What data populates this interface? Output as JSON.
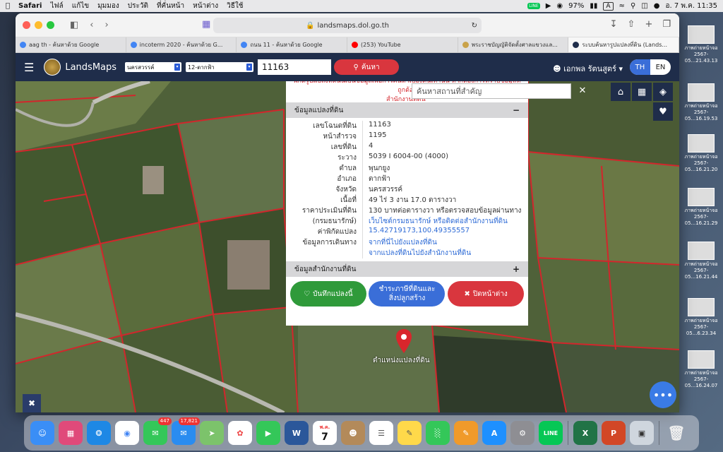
{
  "menubar": {
    "apple": "",
    "app": "Safari",
    "items": [
      "ไฟล์",
      "แก้ไข",
      "มุมมอง",
      "ประวัติ",
      "ที่คั่นหน้า",
      "หน้าต่าง",
      "วิธีใช้"
    ],
    "battery": "97%",
    "input_source": "A",
    "clock": "อ. 7 พ.ค.  11:35"
  },
  "safari": {
    "url": "landsmaps.dol.go.th",
    "tabs": [
      {
        "label": "aag th - ค้นหาด้วย Google",
        "color": "#4285f4"
      },
      {
        "label": "incoterm 2020 - ค้นหาด้วย G...",
        "color": "#4285f4"
      },
      {
        "label": "ถนน 11 - ค้นหาด้วย Google",
        "color": "#4285f4"
      },
      {
        "label": "(253) YouTube",
        "color": "#ff0000"
      },
      {
        "label": "พระราชบัญญัติจัดตั้งศาลแขวงแล...",
        "color": "#c9a24a"
      },
      {
        "label": "ระบบค้นหารูปแปลงที่ดิน (Lands...",
        "color": "#1f2d4a"
      }
    ]
  },
  "landsmaps": {
    "brand": "LandsMaps",
    "province_select": "นครสวรรค์",
    "district_select": "12-ตากฟ้า",
    "parcel_value": "11163",
    "search_label": "ค้นหา",
    "user_name": "เอกพล รัตนสูตร์",
    "lang_th": "TH",
    "lang_en": "EN",
    "landmark_placeholder": "ค้นหาสถานที่สำคัญ",
    "notice_line1": "พิกัดรูปแปลงที่ดินนี้เป็นข้อมูลเพื่อการค้นหาเบื้องต้นเท่านั้น หากต้องการทราบข้อมูลที่ถูกต้อง",
    "notice_line2": "สำนักงานที่ดิน",
    "section_parcel": "ข้อมูลแปลงที่ดิน",
    "section_office": "ข้อมูลสำนักงานที่ดิน",
    "parcel_rows": [
      {
        "k": "เลขโฉนดที่ดิน",
        "v": "11163"
      },
      {
        "k": "หน้าสำรวจ",
        "v": "1195"
      },
      {
        "k": "เลขที่ดิน",
        "v": "4"
      },
      {
        "k": "ระวาง",
        "v": "5039 I 6004-00 (4000)"
      },
      {
        "k": "ตำบล",
        "v": "พุนกยูง"
      },
      {
        "k": "อำเภอ",
        "v": "ตากฟ้า"
      },
      {
        "k": "จังหวัด",
        "v": "นครสวรรค์"
      },
      {
        "k": "เนื้อที่",
        "v": "49 ไร่ 3 งาน 17.0 ตารางวา"
      },
      {
        "k": "ราคาประเมินที่ดิน",
        "v": "130 บาทต่อตารางวา หรือตรวจสอบข้อมูลผ่านทาง"
      },
      {
        "k": "(กรมธนารักษ์)",
        "v": "เว็บไซต์กรมธนารักษ์ หรือติดต่อสำนักงานที่ดิน"
      },
      {
        "k": "ค่าพิกัดแปลง",
        "v": "15.42719173,100.49355557"
      },
      {
        "k": "ข้อมูลการเดินทาง",
        "v": "จากที่นี่ไปยังแปลงที่ดิน"
      },
      {
        "k": "",
        "v": "จากแปลงที่ดินไปยังสำนักงานที่ดิน"
      }
    ],
    "save_label": "บันทึกแปลงนี้",
    "tax_label_1": "ชำระภาษีที่ดินและ",
    "tax_label_2": "สิ่งปลูกสร้าง",
    "close_label": "ปิดหน้าต่าง",
    "pin_label": "ตำแหน่งแปลงที่ดิน"
  },
  "desktop_files": [
    {
      "label": "ภาพถ่ายหน้าจอ",
      "time": "2567-05...21.43.13"
    },
    {
      "label": "ภาพถ่ายหน้าจอ",
      "time": "2567-05...16.19.53"
    },
    {
      "label": "ภาพถ่ายหน้าจอ",
      "time": "2567-05...16.21.20"
    },
    {
      "label": "ภาพถ่ายหน้าจอ",
      "time": "2567-05...16.21.29"
    },
    {
      "label": "ภาพถ่ายหน้าจอ",
      "time": "2567-05...16.21.44"
    },
    {
      "label": "ภาพถ่ายหน้าจอ",
      "time": "2567-05...6.23.34"
    },
    {
      "label": "ภาพถ่ายหน้าจอ",
      "time": "2567-05...16.24.07"
    }
  ],
  "dock": {
    "messages_badge": "447",
    "mail_badge": "17,821",
    "calendar_month": "พ.ค.",
    "calendar_day": "7",
    "line_label": "LINE"
  }
}
